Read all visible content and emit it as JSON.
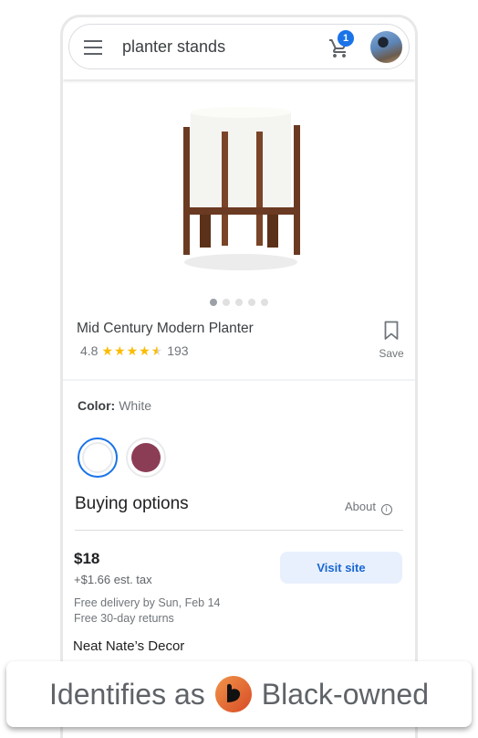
{
  "search": {
    "query": "planter stands",
    "cart_count": "1"
  },
  "product": {
    "title": "Mid Century Modern Planter",
    "rating": "4.8",
    "stars_value": 4.5,
    "stars_filled": "★★★★",
    "stars_half": "★",
    "review_count": "193",
    "save_label": "Save",
    "image_count": 5,
    "active_image": 1
  },
  "color": {
    "label": "Color:",
    "selected": "White",
    "options": [
      {
        "name": "White",
        "hex": "#ffffff"
      },
      {
        "name": "Plum",
        "hex": "#8c3d56"
      }
    ]
  },
  "buying": {
    "title": "Buying options",
    "about_label": "About",
    "info_glyph": "i",
    "offer": {
      "price": "$18",
      "tax": "+$1.66 est. tax",
      "delivery": "Free delivery by Sun, Feb 14",
      "returns": "Free 30-day returns",
      "visit_label": "Visit site",
      "seller": "Neat Nate’s Decor"
    }
  },
  "banner": {
    "prefix": "Identifies as",
    "suffix": "Black-owned"
  },
  "colors": {
    "accent": "#1a73e8",
    "star": "#fbbc04",
    "badge_orange": "#e8652f"
  }
}
